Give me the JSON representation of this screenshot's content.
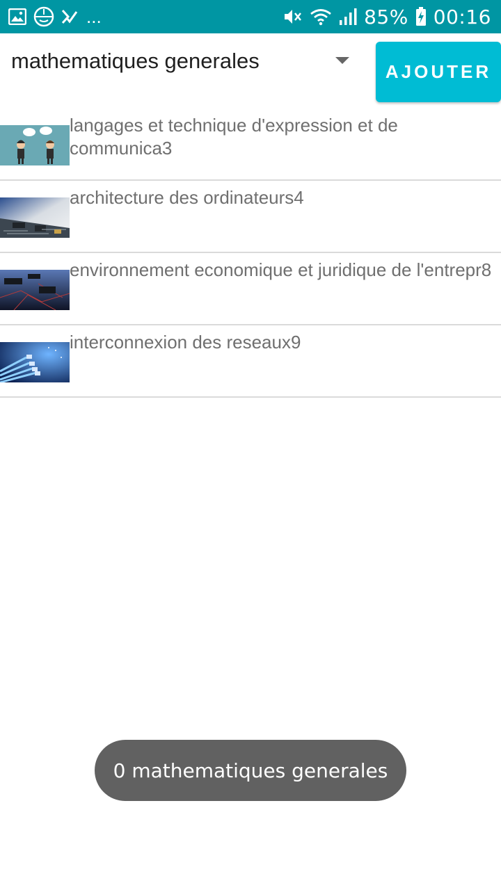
{
  "status_bar": {
    "overflow": "...",
    "battery": "85%",
    "time": "00:16",
    "left_icons": [
      "image-icon",
      "app-logo-icon",
      "check-icon"
    ],
    "right_icons": [
      "mute-icon",
      "wifi-icon",
      "signal-icon",
      "battery-charging-icon"
    ]
  },
  "spinner": {
    "selected": "mathematiques generales"
  },
  "add_button": {
    "label": "AJOUTER"
  },
  "list": [
    {
      "title": "langages et technique d'expression et de communica3",
      "icon": "people-talking-thumbnail"
    },
    {
      "title": "architecture des ordinateurs4",
      "icon": "circuit-board-thumbnail"
    },
    {
      "title": "environnement economique et juridique de l'entrepr8",
      "icon": "chips-network-thumbnail"
    },
    {
      "title": "interconnexion des reseaux9",
      "icon": "network-cables-thumbnail"
    }
  ],
  "toast": {
    "text": "0 mathematiques generales"
  },
  "colors": {
    "status_bar": "#0096a3",
    "button": "#00bcd4",
    "toast": "#616161",
    "item_text": "#6f6f6f"
  }
}
